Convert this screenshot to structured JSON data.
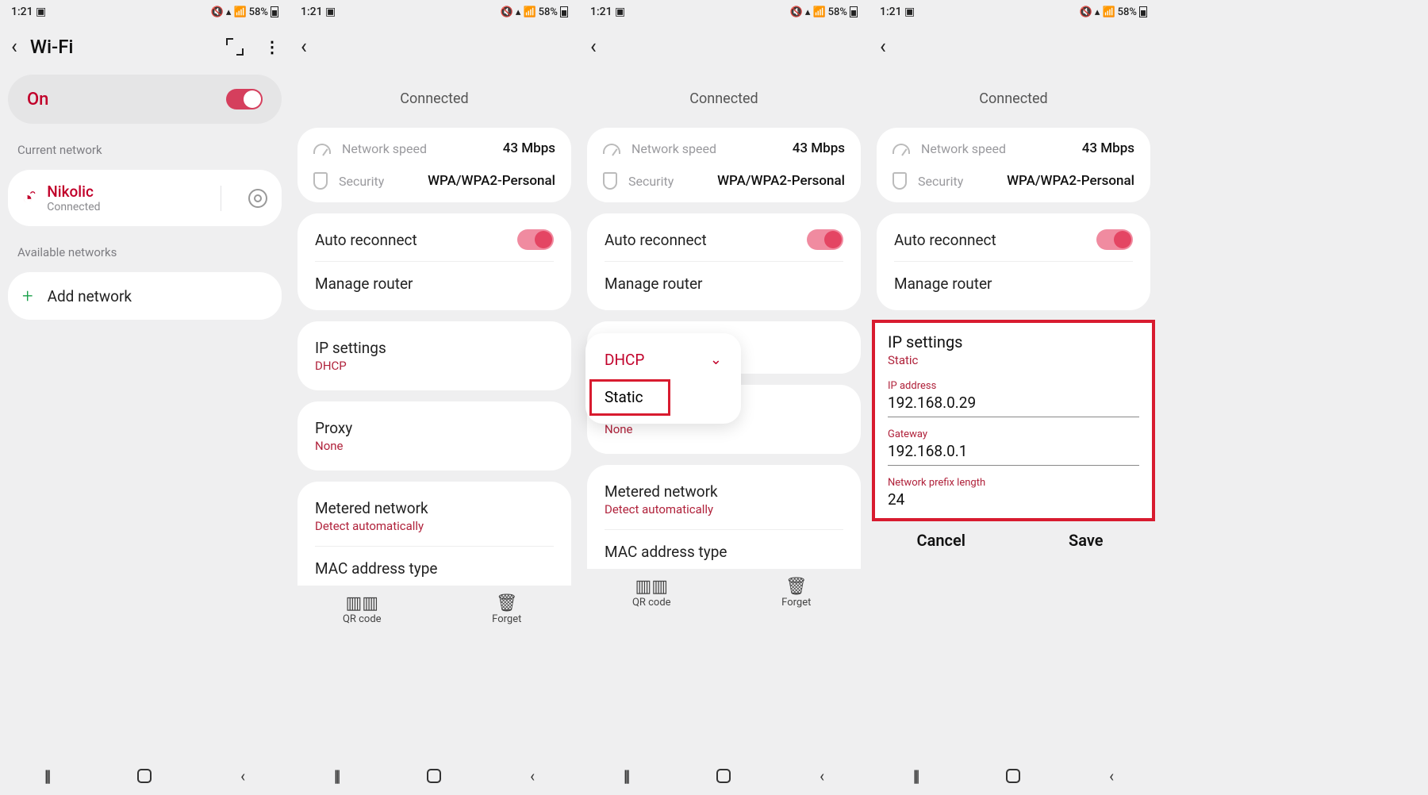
{
  "status": {
    "time": "1:21",
    "battery": "58%"
  },
  "pane1": {
    "title": "Wi-Fi",
    "on_label": "On",
    "current_header": "Current network",
    "network_name": "Nikolic",
    "network_status": "Connected",
    "available_header": "Available networks",
    "add_network": "Add network"
  },
  "detail": {
    "connected": "Connected",
    "speed_label": "Network speed",
    "speed_value": "43 Mbps",
    "security_label": "Security",
    "security_value": "WPA/WPA2-Personal",
    "auto_reconnect": "Auto reconnect",
    "manage_router": "Manage router",
    "ip_settings": "IP settings",
    "ip_dhcp": "DHCP",
    "proxy": "Proxy",
    "proxy_val": "None",
    "metered": "Metered network",
    "metered_val": "Detect automatically",
    "mac": "MAC address type",
    "qr": "QR code",
    "forget": "Forget"
  },
  "popup": {
    "dhcp": "DHCP",
    "static": "Static"
  },
  "ipform": {
    "title": "IP settings",
    "mode": "Static",
    "ip_label": "IP address",
    "ip_value": "192.168.0.29",
    "gw_label": "Gateway",
    "gw_value": "192.168.0.1",
    "pl_label": "Network prefix length",
    "pl_value": "24",
    "cancel": "Cancel",
    "save": "Save"
  }
}
